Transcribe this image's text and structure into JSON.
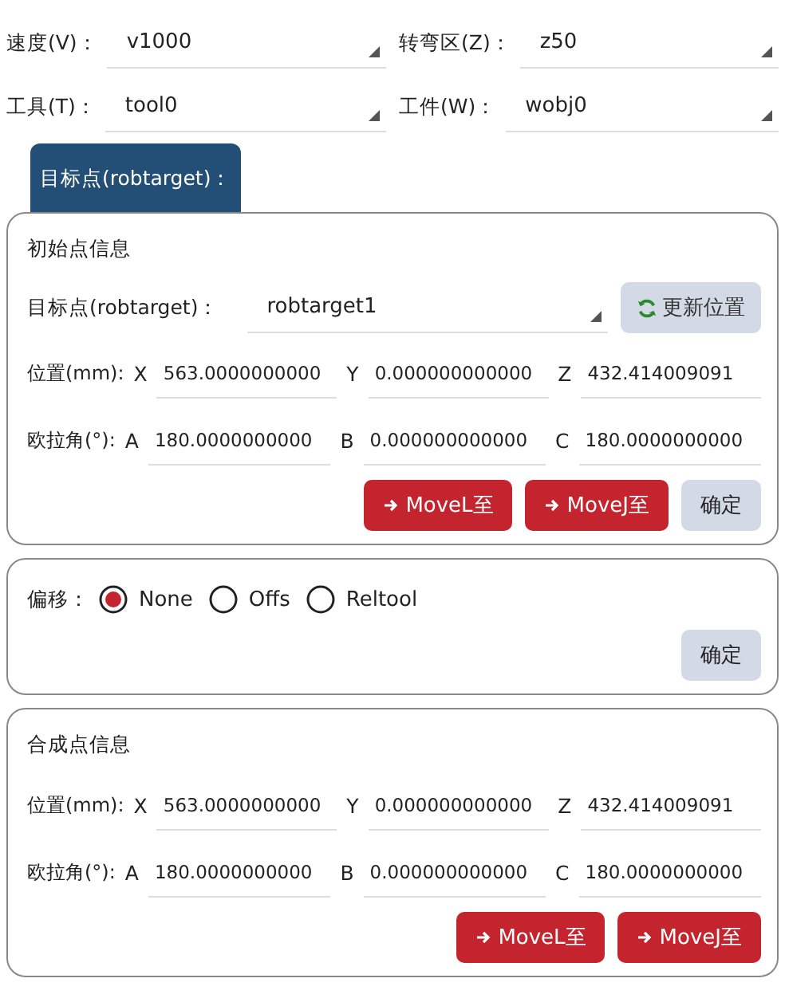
{
  "selects": [
    {
      "label": "速度(V)：",
      "value": "v1000"
    },
    {
      "label": "转弯区(Z)：",
      "value": "z50"
    },
    {
      "label": "工具(T)：",
      "value": "tool0"
    },
    {
      "label": "工件(W)：",
      "value": "wobj0"
    }
  ],
  "tab": {
    "label": "目标点(robtarget)："
  },
  "initial": {
    "title": "初始点信息",
    "target_label": "目标点(robtarget)：",
    "target_value": "robtarget1",
    "refresh_button": "更新位置",
    "rows": [
      {
        "label": "位置(mm):",
        "fields": [
          {
            "axis": "X",
            "value": "563.0000000000"
          },
          {
            "axis": "Y",
            "value": "0.000000000000"
          },
          {
            "axis": "Z",
            "value": "432.414009091"
          }
        ]
      },
      {
        "label": "欧拉角(°):",
        "fields": [
          {
            "axis": "A",
            "value": "180.0000000000"
          },
          {
            "axis": "B",
            "value": "0.000000000000"
          },
          {
            "axis": "C",
            "value": "180.0000000000"
          }
        ]
      }
    ],
    "buttons": [
      {
        "kind": "move",
        "label": "MoveL至"
      },
      {
        "kind": "move",
        "label": "MoveJ至"
      },
      {
        "kind": "confirm",
        "label": "确定"
      }
    ]
  },
  "offset": {
    "label": "偏移：",
    "options": [
      {
        "label": "None",
        "selected": true
      },
      {
        "label": "Offs",
        "selected": false
      },
      {
        "label": "Reltool",
        "selected": false
      }
    ],
    "buttons": [
      {
        "kind": "confirm",
        "label": "确定"
      }
    ]
  },
  "result": {
    "title": "合成点信息",
    "rows": [
      {
        "label": "位置(mm):",
        "fields": [
          {
            "axis": "X",
            "value": "563.0000000000"
          },
          {
            "axis": "Y",
            "value": "0.000000000000"
          },
          {
            "axis": "Z",
            "value": "432.414009091"
          }
        ]
      },
      {
        "label": "欧拉角(°):",
        "fields": [
          {
            "axis": "A",
            "value": "180.0000000000"
          },
          {
            "axis": "B",
            "value": "0.000000000000"
          },
          {
            "axis": "C",
            "value": "180.0000000000"
          }
        ]
      }
    ],
    "buttons": [
      {
        "kind": "move",
        "label": "MoveL至"
      },
      {
        "kind": "move",
        "label": "MoveJ至"
      }
    ]
  }
}
